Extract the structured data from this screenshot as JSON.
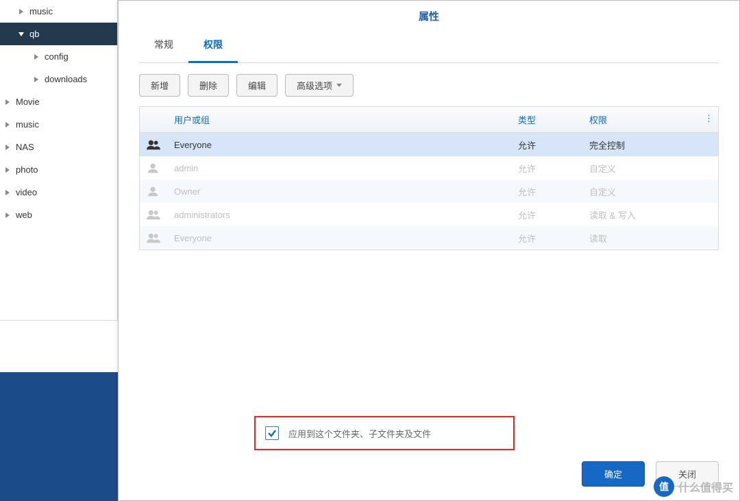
{
  "sidebar": {
    "items": [
      {
        "label": "music",
        "level": 2,
        "expanded": false
      },
      {
        "label": "qb",
        "level": 2,
        "expanded": true
      },
      {
        "label": "config",
        "level": 3,
        "expanded": false
      },
      {
        "label": "downloads",
        "level": 3,
        "expanded": false
      },
      {
        "label": "Movie",
        "level": 1,
        "expanded": false
      },
      {
        "label": "music",
        "level": 1,
        "expanded": false
      },
      {
        "label": "NAS",
        "level": 1,
        "expanded": false
      },
      {
        "label": "photo",
        "level": 1,
        "expanded": false
      },
      {
        "label": "video",
        "level": 1,
        "expanded": false
      },
      {
        "label": "web",
        "level": 1,
        "expanded": false
      }
    ]
  },
  "dialog": {
    "title": "属性",
    "tabs": [
      {
        "label": "常规",
        "active": false
      },
      {
        "label": "权限",
        "active": true
      }
    ],
    "toolbar": {
      "add": "新增",
      "delete": "删除",
      "edit": "编辑",
      "advanced": "高级选项"
    },
    "columns": {
      "user": "用户或组",
      "type": "类型",
      "permission": "权限"
    },
    "rows": [
      {
        "icon": "group-dark",
        "user": "Everyone",
        "type": "允许",
        "perm": "完全控制",
        "sel": true,
        "dim": false
      },
      {
        "icon": "user-light",
        "user": "admin",
        "type": "允许",
        "perm": "自定义",
        "sel": false,
        "dim": true
      },
      {
        "icon": "user-light",
        "user": "Owner",
        "type": "允许",
        "perm": "自定义",
        "sel": false,
        "dim": true,
        "alt": true
      },
      {
        "icon": "group-light",
        "user": "administrators",
        "type": "允许",
        "perm": "读取 & 写入",
        "sel": false,
        "dim": true
      },
      {
        "icon": "group-light",
        "user": "Everyone",
        "type": "允许",
        "perm": "读取",
        "sel": false,
        "dim": true,
        "alt": true
      }
    ],
    "apply_checkbox": {
      "checked": true,
      "label": "应用到这个文件夹、子文件夹及文件"
    },
    "buttons": {
      "ok": "确定",
      "close": "关闭"
    }
  },
  "watermark": {
    "badge": "值",
    "text": "什么值得买"
  }
}
